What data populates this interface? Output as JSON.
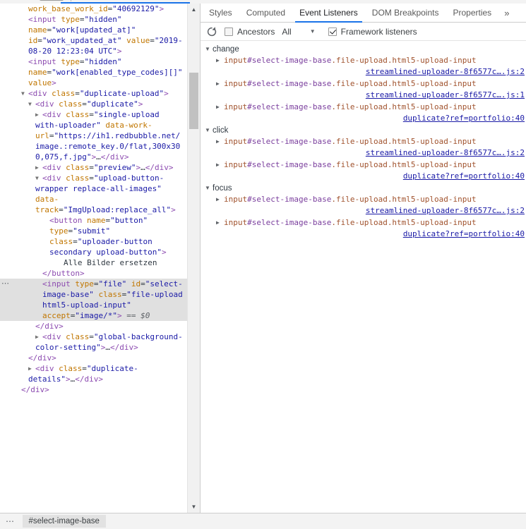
{
  "window": {
    "title": "Chrome DevTools - Elements panel"
  },
  "dom_panel": {
    "name": "elements-dom-tree",
    "scrollbar": {
      "up_arrow": "▲",
      "down_arrow": "▼"
    },
    "nodes": [
      {
        "id": "n0",
        "indent": 4,
        "selected": false,
        "twist": "",
        "segments": [
          {
            "t": "attr",
            "v": "work_base_work_id"
          },
          {
            "t": "plain",
            "v": "="
          },
          {
            "t": "val",
            "v": "\"40692129\""
          },
          {
            "t": "punct",
            "v": ">"
          }
        ]
      },
      {
        "id": "n1",
        "indent": 4,
        "selected": false,
        "twist": "",
        "segments": [
          {
            "t": "punct",
            "v": "<"
          },
          {
            "t": "tag",
            "v": "input"
          },
          {
            "t": "plain",
            "v": " "
          },
          {
            "t": "attr",
            "v": "type"
          },
          {
            "t": "plain",
            "v": "="
          },
          {
            "t": "val",
            "v": "\"hidden\""
          },
          {
            "t": "plain",
            "v": " "
          },
          {
            "t": "attr",
            "v": "name"
          },
          {
            "t": "plain",
            "v": "="
          },
          {
            "t": "val",
            "v": "\"work[updated_at]\""
          },
          {
            "t": "plain",
            "v": " "
          },
          {
            "t": "attr",
            "v": "id"
          },
          {
            "t": "plain",
            "v": "="
          },
          {
            "t": "val",
            "v": "\"work_updated_at\""
          },
          {
            "t": "plain",
            "v": " "
          },
          {
            "t": "attr",
            "v": "value"
          },
          {
            "t": "plain",
            "v": "="
          },
          {
            "t": "val",
            "v": "\"2019-08-20 12:23:04 UTC\""
          },
          {
            "t": "punct",
            "v": ">"
          }
        ]
      },
      {
        "id": "n2",
        "indent": 4,
        "selected": false,
        "twist": "",
        "segments": [
          {
            "t": "punct",
            "v": "<"
          },
          {
            "t": "tag",
            "v": "input"
          },
          {
            "t": "plain",
            "v": " "
          },
          {
            "t": "attr",
            "v": "type"
          },
          {
            "t": "plain",
            "v": "="
          },
          {
            "t": "val",
            "v": "\"hidden\""
          },
          {
            "t": "plain",
            "v": " "
          },
          {
            "t": "attr",
            "v": "name"
          },
          {
            "t": "plain",
            "v": "="
          },
          {
            "t": "val",
            "v": "\"work[enabled_type_codes][]\""
          },
          {
            "t": "plain",
            "v": " "
          },
          {
            "t": "attr",
            "v": "value"
          },
          {
            "t": "punct",
            "v": ">"
          }
        ]
      },
      {
        "id": "n3",
        "indent": 3,
        "selected": false,
        "twist": "▼",
        "segments": [
          {
            "t": "punct",
            "v": "<"
          },
          {
            "t": "tag",
            "v": "div"
          },
          {
            "t": "plain",
            "v": " "
          },
          {
            "t": "attr",
            "v": "class"
          },
          {
            "t": "plain",
            "v": "="
          },
          {
            "t": "val",
            "v": "\"duplicate-upload\""
          },
          {
            "t": "punct",
            "v": ">"
          }
        ]
      },
      {
        "id": "n4",
        "indent": 4,
        "selected": false,
        "twist": "▼",
        "segments": [
          {
            "t": "punct",
            "v": "<"
          },
          {
            "t": "tag",
            "v": "div"
          },
          {
            "t": "plain",
            "v": " "
          },
          {
            "t": "attr",
            "v": "class"
          },
          {
            "t": "plain",
            "v": "="
          },
          {
            "t": "val",
            "v": "\"duplicate\""
          },
          {
            "t": "punct",
            "v": ">"
          }
        ]
      },
      {
        "id": "n5",
        "indent": 5,
        "selected": false,
        "twist": "▶",
        "segments": [
          {
            "t": "punct",
            "v": "<"
          },
          {
            "t": "tag",
            "v": "div"
          },
          {
            "t": "plain",
            "v": " "
          },
          {
            "t": "attr",
            "v": "class"
          },
          {
            "t": "plain",
            "v": "="
          },
          {
            "t": "val",
            "v": "\"single-upload with-uploader\""
          },
          {
            "t": "plain",
            "v": " "
          },
          {
            "t": "attr",
            "v": "data-work-url"
          },
          {
            "t": "plain",
            "v": "="
          },
          {
            "t": "val",
            "v": "\"https://ih1.redbubble.net/image.:remote_key.0/flat,300x300,075,f.jpg\""
          },
          {
            "t": "punct",
            "v": ">"
          },
          {
            "t": "text",
            "v": "…"
          },
          {
            "t": "close",
            "v": "</div>"
          }
        ]
      },
      {
        "id": "n6",
        "indent": 5,
        "selected": false,
        "twist": "▶",
        "segments": [
          {
            "t": "punct",
            "v": "<"
          },
          {
            "t": "tag",
            "v": "div"
          },
          {
            "t": "plain",
            "v": " "
          },
          {
            "t": "attr",
            "v": "class"
          },
          {
            "t": "plain",
            "v": "="
          },
          {
            "t": "val",
            "v": "\"preview\""
          },
          {
            "t": "punct",
            "v": ">"
          },
          {
            "t": "text",
            "v": "…"
          },
          {
            "t": "close",
            "v": "</div>"
          }
        ]
      },
      {
        "id": "n7",
        "indent": 5,
        "selected": false,
        "twist": "▼",
        "segments": [
          {
            "t": "punct",
            "v": "<"
          },
          {
            "t": "tag",
            "v": "div"
          },
          {
            "t": "plain",
            "v": " "
          },
          {
            "t": "attr",
            "v": "class"
          },
          {
            "t": "plain",
            "v": "="
          },
          {
            "t": "val",
            "v": "\"upload-button-wrapper replace-all-images\""
          },
          {
            "t": "plain",
            "v": " "
          },
          {
            "t": "attr",
            "v": "data-track"
          },
          {
            "t": "plain",
            "v": "="
          },
          {
            "t": "val",
            "v": "\"ImgUpload:replace_all\""
          },
          {
            "t": "punct",
            "v": ">"
          }
        ]
      },
      {
        "id": "n8",
        "indent": 7,
        "selected": false,
        "twist": "",
        "segments": [
          {
            "t": "punct",
            "v": "<"
          },
          {
            "t": "tag",
            "v": "button"
          },
          {
            "t": "plain",
            "v": " "
          },
          {
            "t": "attr",
            "v": "name"
          },
          {
            "t": "plain",
            "v": "="
          },
          {
            "t": "val",
            "v": "\"button\""
          },
          {
            "t": "plain",
            "v": " "
          },
          {
            "t": "attr",
            "v": "type"
          },
          {
            "t": "plain",
            "v": "="
          },
          {
            "t": "val",
            "v": "\"submit\""
          },
          {
            "t": "plain",
            "v": " "
          },
          {
            "t": "attr",
            "v": "class"
          },
          {
            "t": "plain",
            "v": "="
          },
          {
            "t": "val",
            "v": "\"uploader-button secondary upload-button\""
          },
          {
            "t": "punct",
            "v": ">"
          }
        ]
      },
      {
        "id": "n9",
        "indent": 9,
        "selected": false,
        "twist": "",
        "segments": [
          {
            "t": "text",
            "v": "Alle Bilder ersetzen"
          }
        ]
      },
      {
        "id": "n10",
        "indent": 6,
        "selected": false,
        "twist": "",
        "segments": [
          {
            "t": "close",
            "v": "</button>"
          }
        ]
      },
      {
        "id": "n11",
        "indent": 6,
        "selected": true,
        "twist": "",
        "ellipsis": "⋯",
        "segments": [
          {
            "t": "punct",
            "v": "<"
          },
          {
            "t": "tag",
            "v": "input"
          },
          {
            "t": "plain",
            "v": " "
          },
          {
            "t": "attr",
            "v": "type"
          },
          {
            "t": "plain",
            "v": "="
          },
          {
            "t": "val",
            "v": "\"file\""
          },
          {
            "t": "plain",
            "v": " "
          },
          {
            "t": "attr",
            "v": "id"
          },
          {
            "t": "plain",
            "v": "="
          },
          {
            "t": "val",
            "v": "\"select-image-base\""
          },
          {
            "t": "plain",
            "v": " "
          },
          {
            "t": "attr",
            "v": "class"
          },
          {
            "t": "plain",
            "v": "="
          },
          {
            "t": "val",
            "v": "\"file-upload html5-upload-input\""
          },
          {
            "t": "plain",
            "v": " "
          },
          {
            "t": "attr",
            "v": "accept"
          },
          {
            "t": "plain",
            "v": "="
          },
          {
            "t": "val",
            "v": "\"image/*\""
          },
          {
            "t": "punct",
            "v": ">"
          },
          {
            "t": "eqdollar",
            "v": " == $0"
          }
        ]
      },
      {
        "id": "n12",
        "indent": 5,
        "selected": false,
        "twist": "",
        "segments": [
          {
            "t": "close",
            "v": "</div>"
          }
        ]
      },
      {
        "id": "n13",
        "indent": 5,
        "selected": false,
        "twist": "▶",
        "segments": [
          {
            "t": "punct",
            "v": "<"
          },
          {
            "t": "tag",
            "v": "div"
          },
          {
            "t": "plain",
            "v": " "
          },
          {
            "t": "attr",
            "v": "class"
          },
          {
            "t": "plain",
            "v": "="
          },
          {
            "t": "val",
            "v": "\"global-background-color-setting\""
          },
          {
            "t": "punct",
            "v": ">"
          },
          {
            "t": "text",
            "v": "…"
          },
          {
            "t": "close",
            "v": "</div>"
          }
        ]
      },
      {
        "id": "n14",
        "indent": 4,
        "selected": false,
        "twist": "",
        "segments": [
          {
            "t": "close",
            "v": "</div>"
          }
        ]
      },
      {
        "id": "n15",
        "indent": 4,
        "selected": false,
        "twist": "▶",
        "segments": [
          {
            "t": "punct",
            "v": "<"
          },
          {
            "t": "tag",
            "v": "div"
          },
          {
            "t": "plain",
            "v": " "
          },
          {
            "t": "attr",
            "v": "class"
          },
          {
            "t": "plain",
            "v": "="
          },
          {
            "t": "val",
            "v": "\"duplicate-details\""
          },
          {
            "t": "punct",
            "v": ">"
          },
          {
            "t": "text",
            "v": "…"
          },
          {
            "t": "close",
            "v": "</div>"
          }
        ]
      },
      {
        "id": "n16",
        "indent": 3,
        "selected": false,
        "twist": "",
        "segments": [
          {
            "t": "close",
            "v": "</div>"
          }
        ]
      }
    ]
  },
  "sidebar": {
    "tabs": [
      {
        "label": "Styles",
        "active": false
      },
      {
        "label": "Computed",
        "active": false
      },
      {
        "label": "Event Listeners",
        "active": true
      },
      {
        "label": "DOM Breakpoints",
        "active": false
      },
      {
        "label": "Properties",
        "active": false
      }
    ],
    "more_tabs_glyph": "»",
    "toolbar": {
      "refresh_title": "Refresh",
      "ancestors_label": "Ancestors",
      "ancestors_checked": false,
      "filter_value": "All",
      "filter_caret": "▼",
      "framework_label": "Framework listeners",
      "framework_checked": true
    },
    "event_groups": [
      {
        "name": "change",
        "twist": "▼",
        "listeners": [
          {
            "twist": "▶",
            "selector_tag": "input",
            "selector_id": "#select-image-base",
            "selector_classes": ".file-upload.html5-upload-input",
            "source": "streamlined-uploader-8f6577c….js:2"
          },
          {
            "twist": "▶",
            "selector_tag": "input",
            "selector_id": "#select-image-base",
            "selector_classes": ".file-upload.html5-upload-input",
            "source": "streamlined-uploader-8f6577c….js:1"
          },
          {
            "twist": "▶",
            "selector_tag": "input",
            "selector_id": "#select-image-base",
            "selector_classes": ".file-upload.html5-upload-input",
            "source": "duplicate?ref=portfolio:40"
          }
        ]
      },
      {
        "name": "click",
        "twist": "▼",
        "listeners": [
          {
            "twist": "▶",
            "selector_tag": "input",
            "selector_id": "#select-image-base",
            "selector_classes": ".file-upload.html5-upload-input",
            "source": "streamlined-uploader-8f6577c….js:2"
          },
          {
            "twist": "▶",
            "selector_tag": "input",
            "selector_id": "#select-image-base",
            "selector_classes": ".file-upload.html5-upload-input",
            "source": "duplicate?ref=portfolio:40"
          }
        ]
      },
      {
        "name": "focus",
        "twist": "▼",
        "listeners": [
          {
            "twist": "▶",
            "selector_tag": "input",
            "selector_id": "#select-image-base",
            "selector_classes": ".file-upload.html5-upload-input",
            "source": "streamlined-uploader-8f6577c….js:2"
          },
          {
            "twist": "▶",
            "selector_tag": "input",
            "selector_id": "#select-image-base",
            "selector_classes": ".file-upload.html5-upload-input",
            "source": "duplicate?ref=portfolio:40"
          }
        ]
      }
    ]
  },
  "breadcrumb": {
    "overflow_glyph": "⋯",
    "crumbs": [
      {
        "label": "#select-image-base",
        "selected": true
      }
    ]
  },
  "colors": {
    "accent": "#1a73e8",
    "tag": "#8c4bb0",
    "attr_name": "#c07600",
    "attr_value": "#1a1aa6",
    "selected_row_bg": "#e0e0e0",
    "panel_border": "#cdcdcd",
    "toolbar_bg": "#f3f3f3"
  }
}
